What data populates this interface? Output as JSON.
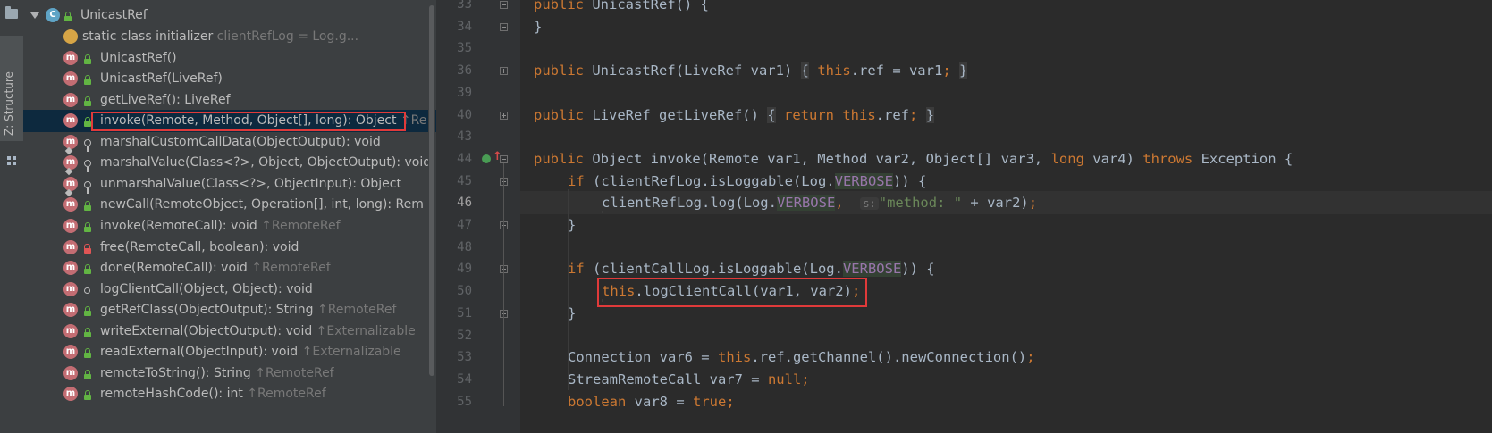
{
  "tool_strip": {
    "structure_tab_label": "Z: Structure"
  },
  "structure_panel": {
    "class_name": "UnicastRef",
    "items": [
      {
        "icon": "static-initializer-icon",
        "visibility": "none",
        "label": "static class initializer",
        "hint": "clientRefLog = Log.g..."
      },
      {
        "icon": "method-icon",
        "visibility": "public",
        "label": "UnicastRef()",
        "hint": ""
      },
      {
        "icon": "method-icon",
        "visibility": "public",
        "label": "UnicastRef(LiveRef)",
        "hint": ""
      },
      {
        "icon": "method-icon",
        "visibility": "public",
        "label": "getLiveRef(): LiveRef",
        "hint": ""
      },
      {
        "icon": "method-icon",
        "visibility": "public",
        "label": "invoke(Remote, Method, Object[], long): Object",
        "hint": "↑Re"
      },
      {
        "icon": "method-icon",
        "visibility": "protected",
        "label": "marshalCustomCallData(ObjectOutput): void",
        "hint": ""
      },
      {
        "icon": "method-icon",
        "visibility": "protected",
        "label": "marshalValue(Class<?>, Object, ObjectOutput): void",
        "hint": ""
      },
      {
        "icon": "method-icon",
        "visibility": "protected",
        "label": "unmarshalValue(Class<?>, ObjectInput): Object",
        "hint": ""
      },
      {
        "icon": "method-icon",
        "visibility": "public",
        "label": "newCall(RemoteObject, Operation[], int, long): Rem",
        "hint": ""
      },
      {
        "icon": "method-icon",
        "visibility": "public",
        "label": "invoke(RemoteCall): void",
        "hint": "↑RemoteRef"
      },
      {
        "icon": "method-icon",
        "visibility": "private",
        "label": "free(RemoteCall, boolean): void",
        "hint": ""
      },
      {
        "icon": "method-icon",
        "visibility": "public",
        "label": "done(RemoteCall): void",
        "hint": "↑RemoteRef"
      },
      {
        "icon": "method-icon",
        "visibility": "package",
        "label": "logClientCall(Object, Object): void",
        "hint": ""
      },
      {
        "icon": "method-icon",
        "visibility": "public",
        "label": "getRefClass(ObjectOutput): String",
        "hint": "↑RemoteRef"
      },
      {
        "icon": "method-icon",
        "visibility": "public",
        "label": "writeExternal(ObjectOutput): void",
        "hint": "↑Externalizable"
      },
      {
        "icon": "method-icon",
        "visibility": "public",
        "label": "readExternal(ObjectInput): void",
        "hint": "↑Externalizable"
      },
      {
        "icon": "method-icon",
        "visibility": "public",
        "label": "remoteToString(): String",
        "hint": "↑RemoteRef"
      },
      {
        "icon": "method-icon",
        "visibility": "public",
        "label": "remoteHashCode(): int",
        "hint": "↑RemoteRef"
      }
    ],
    "selected_index": 4
  },
  "editor": {
    "line_numbers": [
      "33",
      "34",
      "35",
      "36",
      "39",
      "40",
      "43",
      "44",
      "45",
      "46",
      "47",
      "48",
      "49",
      "50",
      "51",
      "52",
      "53",
      "54",
      "55"
    ],
    "current_line": "46",
    "lines": {
      "l33": {
        "kw": "public",
        "rest": " UnicastRef() {"
      },
      "l34": "}",
      "l36": {
        "kw": "public",
        "sig": " UnicastRef(LiveRef var1) ",
        "fold_open": "{",
        "body_kw": "this",
        "body_rest": ".ref = var1",
        "semi": ";",
        "fold_close": "}"
      },
      "l40": {
        "kw": "public",
        "sig": " LiveRef getLiveRef() ",
        "fold_open": "{",
        "ret": "return",
        "this": "this",
        "rest": ".ref",
        "semi": ";",
        "fold_close": "}"
      },
      "l44": {
        "kw": "public",
        "t1": " Object invoke(Remote var1, Method var2, Object[] var3, ",
        "long": "long",
        "t2": " var4) ",
        "throws": "throws",
        "t3": " Exception {"
      },
      "l45": {
        "if": "if",
        "t1": " (clientRefLog.isLoggable(Log.",
        "verbose": "VERBOSE",
        "t2": ")) {"
      },
      "l46": {
        "t1": "clientRefLog.log(Log.",
        "verbose": "VERBOSE",
        "comma": ",",
        "hint": "s:",
        "str": "\"method: \"",
        "t2": " + var2)",
        "semi": ";"
      },
      "l47": "}",
      "l49": {
        "if": "if",
        "t1": " (clientCallLog.isLoggable(Log.",
        "verbose": "VERBOSE",
        "t2": ")) {"
      },
      "l50": {
        "this": "this",
        "t1": ".logClientCall(var1, var2)",
        "semi": ";"
      },
      "l51": "}",
      "l53": {
        "t1": "Connection var6 = ",
        "this": "this",
        "t2": ".ref.getChannel().newConnection()",
        "semi": ";"
      },
      "l54": {
        "t1": "StreamRemoteCall var7 = ",
        "null": "null",
        "semi": ";"
      },
      "l55": {
        "bool": "boolean",
        "t1": " var8 = ",
        "true": "true",
        "semi": ";"
      }
    }
  },
  "colors": {
    "keyword": "#cc7832",
    "string": "#6a8759",
    "field": "#9876aa",
    "text": "#a9b7c6",
    "highlight_box": "#e03a3a"
  }
}
